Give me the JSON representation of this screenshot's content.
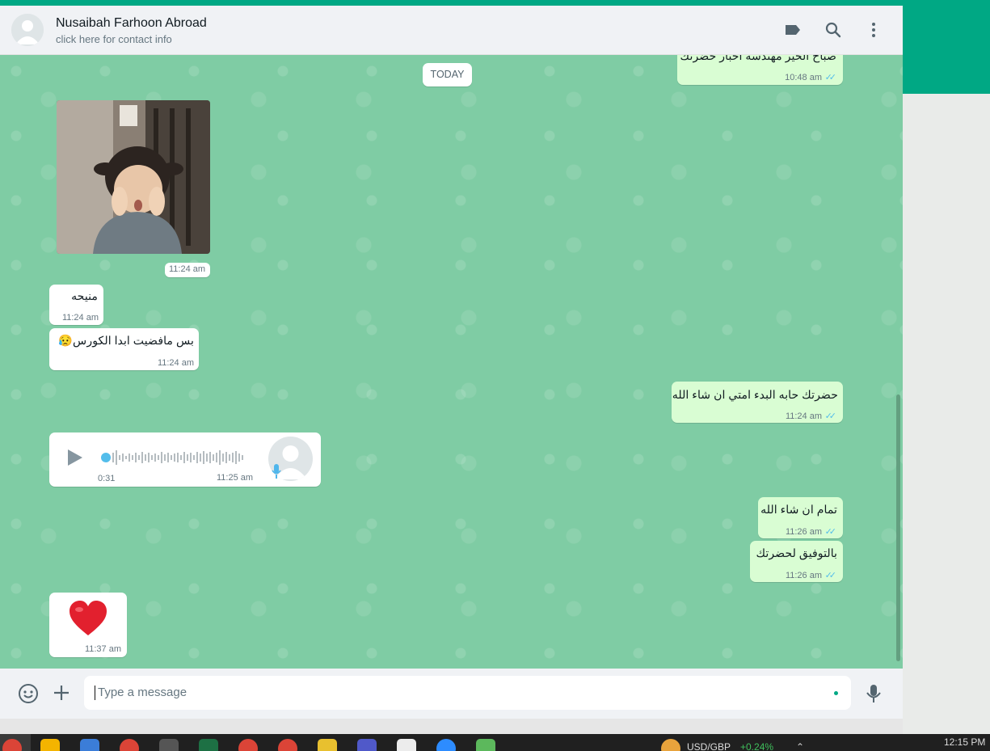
{
  "header": {
    "contact_name": "Nusaibah Farhoon Abroad",
    "contact_subtitle": "click here for contact info",
    "icons": [
      "label-icon",
      "search-icon",
      "menu-icon"
    ]
  },
  "chat": {
    "date_divider": "TODAY",
    "messages": [
      {
        "direction": "out",
        "text": "صباح الخير مهندسة اخبار حضرتك",
        "time": "10:48 am",
        "ticks": "✓✓"
      },
      {
        "direction": "in",
        "type": "image",
        "time": "11:24 am"
      },
      {
        "direction": "in",
        "text": "منيحه",
        "time": "11:24 am"
      },
      {
        "direction": "in",
        "text": "بس مافضيت ابدا الكورس😥",
        "time": "11:24 am"
      },
      {
        "direction": "out",
        "text": "حضرتك حابه البدء امتي ان شاء الله",
        "time": "11:24 am",
        "ticks": "✓✓"
      },
      {
        "direction": "in",
        "type": "voice",
        "duration": "0:31",
        "time": "11:25 am"
      },
      {
        "direction": "out",
        "text": "تمام ان شاء الله",
        "time": "11:26 am",
        "ticks": "✓✓"
      },
      {
        "direction": "out",
        "text": "بالتوفيق لحضرتك",
        "time": "11:26 am",
        "ticks": "✓✓"
      },
      {
        "direction": "in",
        "text": "❤️",
        "time": "11:37 am"
      }
    ]
  },
  "composer": {
    "placeholder": "Type a message"
  },
  "taskbar": {
    "ticker": "USD/GBP",
    "ticker_change": "+0.24%",
    "clock": "12:15 PM"
  },
  "colors": {
    "accent": "#00a884",
    "chat_bg": "#7fcca4",
    "outgoing_bubble": "#d9fdd3",
    "incoming_bubble": "#ffffff",
    "read_ticks": "#53bdeb"
  }
}
